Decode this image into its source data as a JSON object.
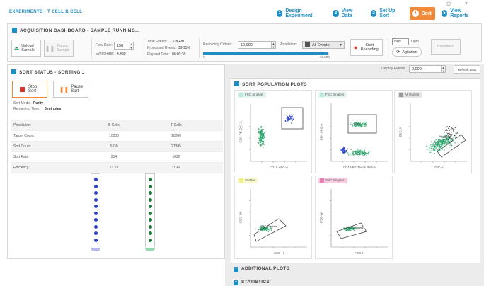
{
  "header": {
    "breadcrumb": "EXPERIMENTS › T CELL B CELL",
    "window_controls": "– ◻ ×",
    "nav": [
      {
        "num": "1",
        "label": "Design Experiment"
      },
      {
        "num": "2",
        "label": "View Data"
      },
      {
        "num": "3",
        "label": "Set Up Sort"
      },
      {
        "num": "4",
        "label": "Sort",
        "active": true
      },
      {
        "num": "5",
        "label": "View Reports"
      }
    ]
  },
  "acquisition": {
    "title": "ACQUISITION DASHBOARD - SAMPLE RUNNING...",
    "unload_label": "Unload Sample",
    "pause_label": "Pause Sample",
    "flow_rate_label": "Flow Rate:",
    "flow_rate_value": "150",
    "event_rate_label": "Event Rate:",
    "event_rate_value": "4,480",
    "total_events_label": "Total Events:",
    "total_events_value": "328,481",
    "processed_label": "Processed Events:",
    "processed_value": "99.95%",
    "elapsed_label": "Elapsed Time:",
    "elapsed_value": "00:02:39",
    "criteria_label": "Recording Criteria:",
    "criteria_value": "10,000",
    "population_label": "Population:",
    "population_value": "All Events",
    "progress_min": "0",
    "progress_max": "10,000",
    "progress": 0.99,
    "start_recording_label": "Start Recording",
    "light_toggle_state": "OFF",
    "light_label": "Light",
    "agitation_label": "Agitation",
    "backflush_label": "Backflush"
  },
  "sort_status": {
    "title": "SORT STATUS - SORTING...",
    "stop_label": "Stop Sort",
    "pause_label": "Pause Sort",
    "mode_label": "Sort Mode:",
    "mode_value": "Purity",
    "remaining_label": "Remaining Time:",
    "remaining_value": "5 minutes",
    "columns": [
      "Population:",
      "B Cells",
      "T Cells"
    ],
    "rows": [
      [
        "Target Count:",
        "10000",
        "10000"
      ],
      [
        "Sort Count:",
        "5330",
        "21385"
      ],
      [
        "Sort Rate:",
        "214",
        "1020"
      ],
      [
        "Efficiency:",
        "71.53",
        "75.46"
      ]
    ]
  },
  "plots": {
    "display_events_label": "Display Events:",
    "display_events_value": "2,000",
    "refresh_label": "Refresh Data",
    "title": "SORT POPULATION PLOTS",
    "panels": [
      {
        "tab": "FSC Singlets",
        "x_label": "CD19 APC-A",
        "y_label": "CD3 PE-Cy7-A",
        "gate": ""
      },
      {
        "tab": "FSC Singlets",
        "x_label": "CD19 PE-Texas Red-A",
        "y_label": "CD4 APC-A",
        "gate": "T Cells"
      },
      {
        "tab": "All Events",
        "x_label": "FSC-A",
        "y_label": "SSC-A",
        "gate": "Singlets"
      },
      {
        "tab": "Scatter",
        "x_label": "SSC-H",
        "y_label": "SSC-W",
        "gate": "SSC Singlets"
      },
      {
        "tab": "SSC Singlets",
        "x_label": "FSC-H",
        "y_label": "FSC-W",
        "gate": "FSC Singlets"
      }
    ],
    "colors": {
      "green": "#2aa66b",
      "blue": "#2b3fc9",
      "tab_teal": "#bfe7dc",
      "tab_yellow": "#eef08a",
      "tab_pink": "#e87fb4",
      "tab_grey": "#9a9a9a"
    }
  },
  "additional_plots_label": "ADDITIONAL PLOTS",
  "statistics_label": "STATISTICS",
  "icons": {
    "unload": "eject-icon",
    "pause": "pause-icon",
    "stop": "stop-icon",
    "record": "record-icon",
    "agitation": "agitation-icon"
  }
}
